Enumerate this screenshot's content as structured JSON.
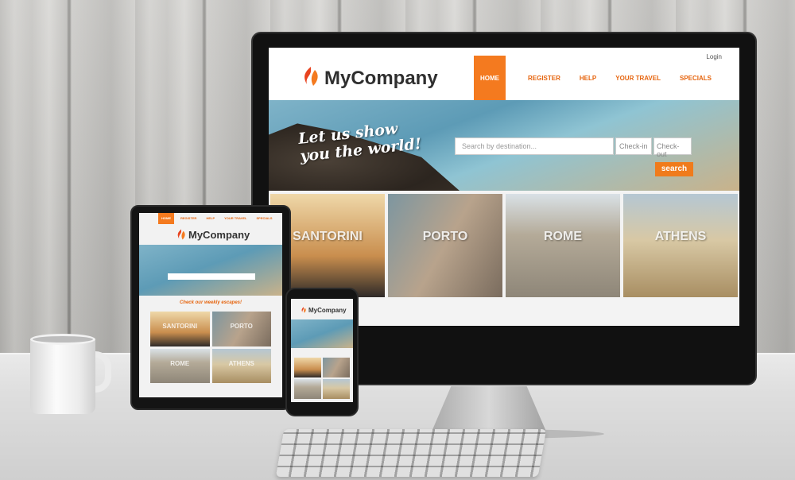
{
  "desktop": {
    "brand": "MyCompany",
    "login": "Login",
    "nav": [
      "HOME",
      "REGISTER",
      "HELP",
      "YOUR TRAVEL",
      "SPECIALS"
    ],
    "hero_line1": "Let us show",
    "hero_line2": "you the world!",
    "search_placeholder": "Search by destination...",
    "checkin": "Check-in",
    "checkout": "Check-out",
    "search_button": "search",
    "cities": [
      "SANTORINI",
      "PORTO",
      "ROME",
      "ATHENS"
    ]
  },
  "tablet": {
    "brand": "MyCompany",
    "nav": [
      "HOME",
      "REGISTER",
      "HELP",
      "YOUR TRAVEL",
      "SPECIALS"
    ],
    "subtitle": "Check our weekly escapes!",
    "cities": [
      "SANTORINI",
      "PORTO",
      "ROME",
      "ATHENS"
    ]
  },
  "phone": {
    "brand": "MyCompany"
  },
  "colors": {
    "accent": "#f47a1f",
    "nav_text": "#e6650f",
    "brand_text": "#2f2f2f"
  },
  "icons": {
    "logo": "flame-logo-icon"
  }
}
